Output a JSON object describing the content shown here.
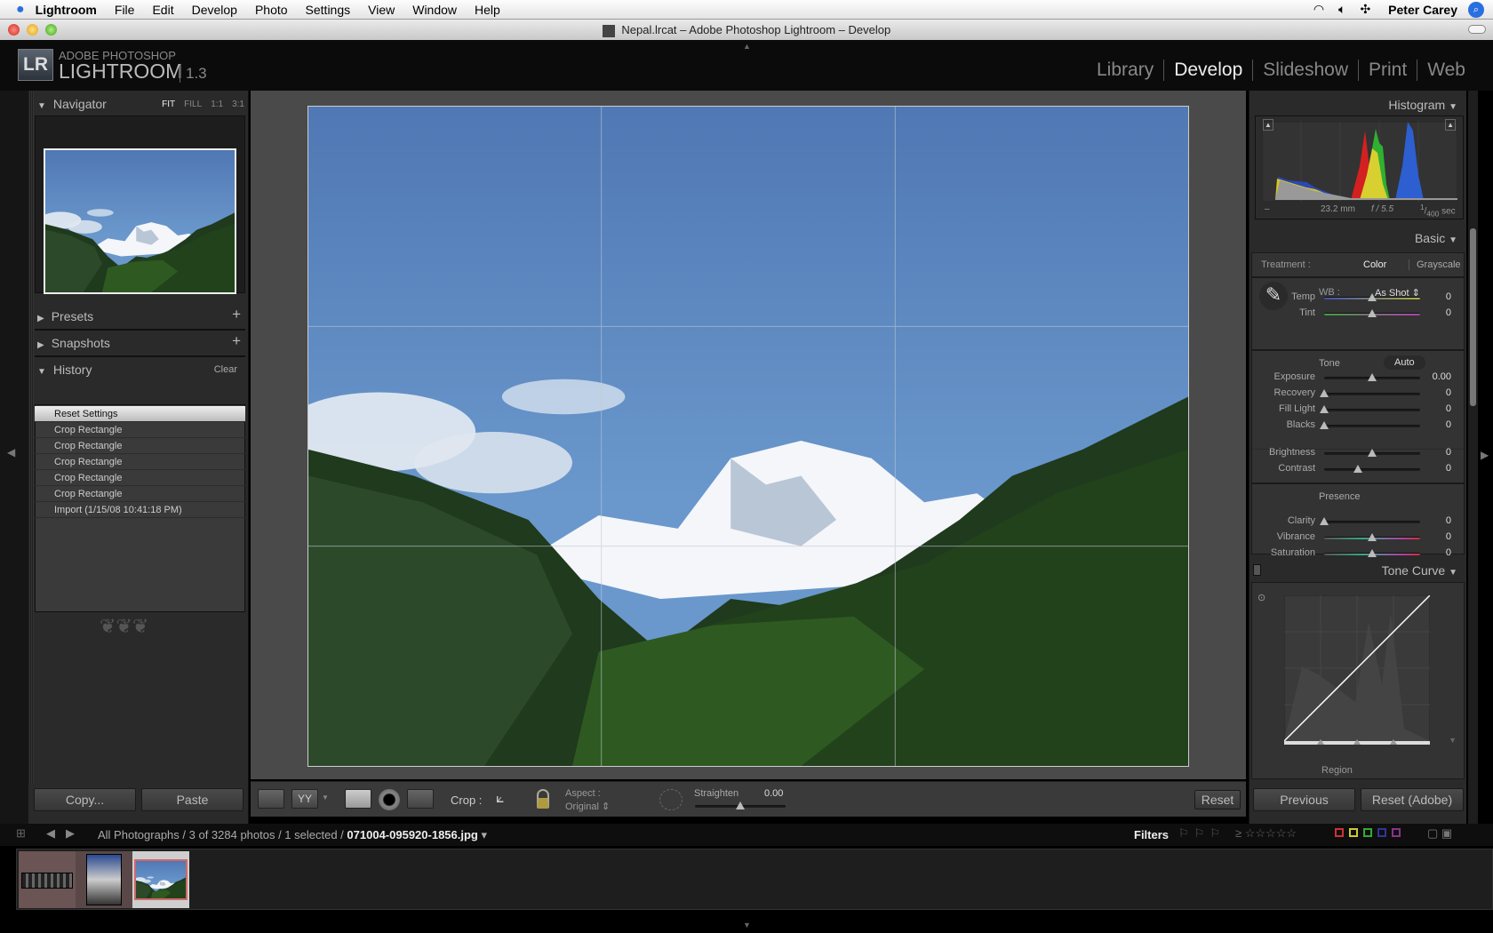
{
  "menubar": {
    "app": "Lightroom",
    "items": [
      "File",
      "Edit",
      "Develop",
      "Photo",
      "Settings",
      "View",
      "Window",
      "Help"
    ],
    "user": "Peter Carey"
  },
  "window": {
    "title": "Nepal.lrcat – Adobe Photoshop Lightroom – Develop"
  },
  "brand": {
    "logo": "LR",
    "line1": "ADOBE PHOTOSHOP",
    "line2": "LIGHTROOM",
    "version": "1.3"
  },
  "modules": [
    "Library",
    "Develop",
    "Slideshow",
    "Print",
    "Web"
  ],
  "active_module": "Develop",
  "left": {
    "navigator": {
      "title": "Navigator",
      "zoom": [
        "FIT",
        "FILL",
        "1:1",
        "3:1"
      ],
      "active_zoom": "FIT"
    },
    "presets": "Presets",
    "snapshots": "Snapshots",
    "history": {
      "title": "History",
      "clear": "Clear",
      "items": [
        "Reset Settings",
        "Crop Rectangle",
        "Crop Rectangle",
        "Crop Rectangle",
        "Crop Rectangle",
        "Crop Rectangle",
        "Import (1/15/08 10:41:18 PM)"
      ],
      "selected": 0
    },
    "copy": "Copy...",
    "paste": "Paste"
  },
  "toolbar": {
    "crop_label": "Crop :",
    "aspect_label": "Aspect :",
    "aspect_value": "Original",
    "straighten_label": "Straighten",
    "straighten_value": "0.00",
    "straighten_fraction": 0.5,
    "reset": "Reset"
  },
  "right": {
    "histogram": {
      "title": "Histogram",
      "focal": "23.2 mm",
      "aperture": "f / 5.5",
      "shutter_num": "1",
      "shutter_den": "400",
      "shutter_unit": "sec",
      "dash": "–"
    },
    "basic": {
      "title": "Basic",
      "treatment_label": "Treatment :",
      "treatment_options": [
        "Color",
        "Grayscale"
      ],
      "treatment_active": "Color",
      "wb_label": "WB :",
      "wb_value": "As Shot",
      "tone_label": "Tone",
      "auto": "Auto",
      "presence_label": "Presence",
      "sliders": [
        {
          "label": "Temp",
          "value": "0",
          "pos": 0.5
        },
        {
          "label": "Tint",
          "value": "0",
          "pos": 0.5
        },
        {
          "label": "Exposure",
          "value": "0.00",
          "pos": 0.5
        },
        {
          "label": "Recovery",
          "value": "0",
          "pos": 0
        },
        {
          "label": "Fill Light",
          "value": "0",
          "pos": 0
        },
        {
          "label": "Blacks",
          "value": "0",
          "pos": 0
        },
        {
          "label": "Brightness",
          "value": "0",
          "pos": 0.5
        },
        {
          "label": "Contrast",
          "value": "0",
          "pos": 0.35
        },
        {
          "label": "Clarity",
          "value": "0",
          "pos": 0
        },
        {
          "label": "Vibrance",
          "value": "0",
          "pos": 0.5
        },
        {
          "label": "Saturation",
          "value": "0",
          "pos": 0.5
        }
      ]
    },
    "tone_curve": {
      "title": "Tone Curve",
      "region": "Region"
    },
    "previous": "Previous",
    "reset_adobe": "Reset (Adobe)"
  },
  "filmstrip": {
    "path": "All Photographs / 3 of 3284 photos / 1 selected / ",
    "filename": "071004-095920-1856.jpg",
    "filters": "Filters"
  },
  "colors": {
    "sky": "#5b86c0",
    "accent_selected": "#d06868"
  }
}
